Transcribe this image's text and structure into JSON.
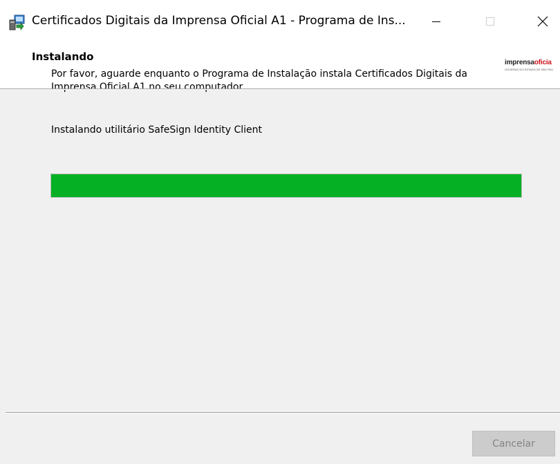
{
  "window": {
    "title": "Certificados Digitais da Imprensa Oficial A1 - Programa de Ins..."
  },
  "header": {
    "heading": "Instalando",
    "description": "Por favor, aguarde enquanto o Programa de Instalação instala Certificados Digitais da Imprensa Oficial A1 no seu computador.",
    "logo": {
      "name_part1": "imprensa",
      "name_part2": "oficia",
      "tagline": "GOVERNO DO ESTADO DE SÃO PAU"
    }
  },
  "main": {
    "status": "Instalando utilitário SafeSign Identity Client",
    "progress_percent": 100
  },
  "footer": {
    "cancel_label": "Cancelar",
    "cancel_enabled": false
  },
  "colors": {
    "progress_fill": "#06b025",
    "logo_accent": "#d0121b"
  },
  "icons": {
    "app": "installer-icon",
    "minimize": "minimize-icon",
    "maximize": "maximize-icon",
    "close": "close-icon"
  }
}
